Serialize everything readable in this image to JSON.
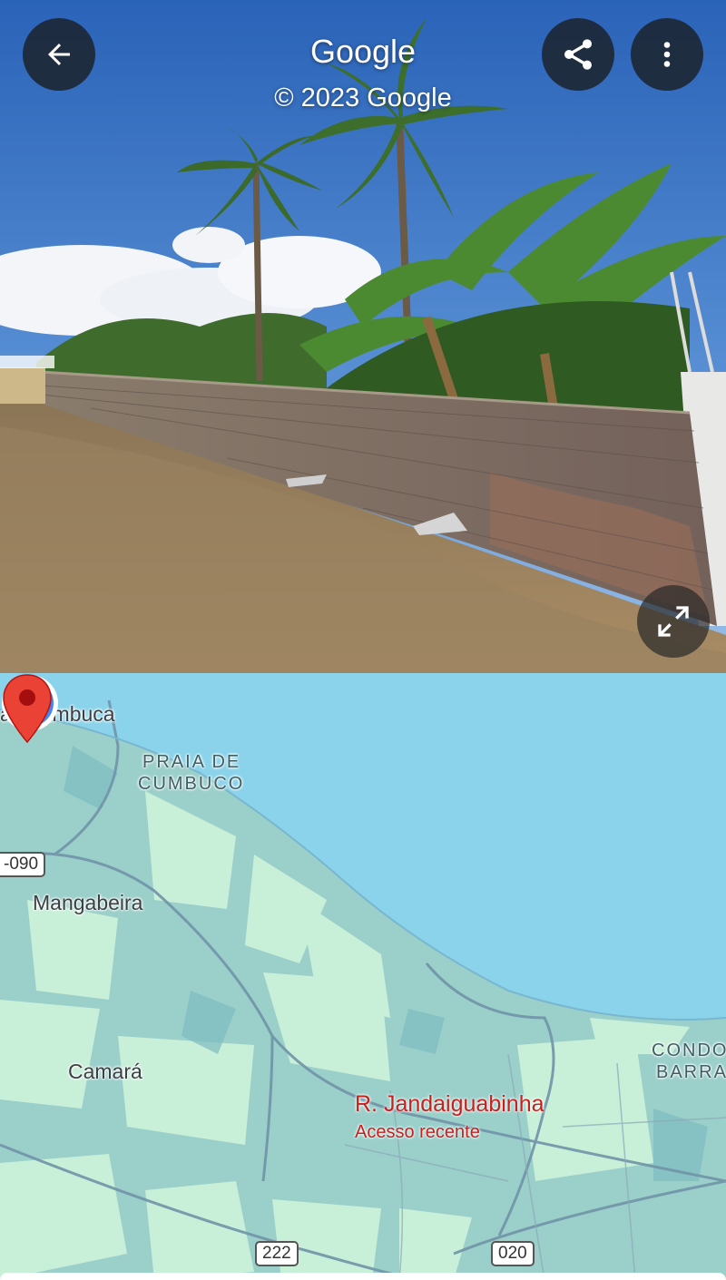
{
  "streetview": {
    "title": "Google",
    "copyright": "© 2023 Google",
    "buttons": {
      "back": "back-arrow-icon",
      "share": "share-icon",
      "more": "more-vert-icon",
      "expand": "expand-icon"
    }
  },
  "map": {
    "labels": {
      "caracambuca": "aracambuca",
      "praia_line1": "PRAIA DE",
      "praia_line2": "CUMBUCO",
      "mangabeira": "Mangabeira",
      "camara": "Camará",
      "condo_line1": "CONDO",
      "condo_line2": "BARRA"
    },
    "shields": {
      "ce090": "-090",
      "br222": "222",
      "ce020": "020"
    },
    "place": {
      "name": "R. Jandaiguabinha",
      "subtitle": "Acesso recente"
    },
    "colors": {
      "water": "#8bd3ea",
      "land": "#9bcfca",
      "green": "#c8efd8",
      "pin": "#ea4335"
    }
  }
}
